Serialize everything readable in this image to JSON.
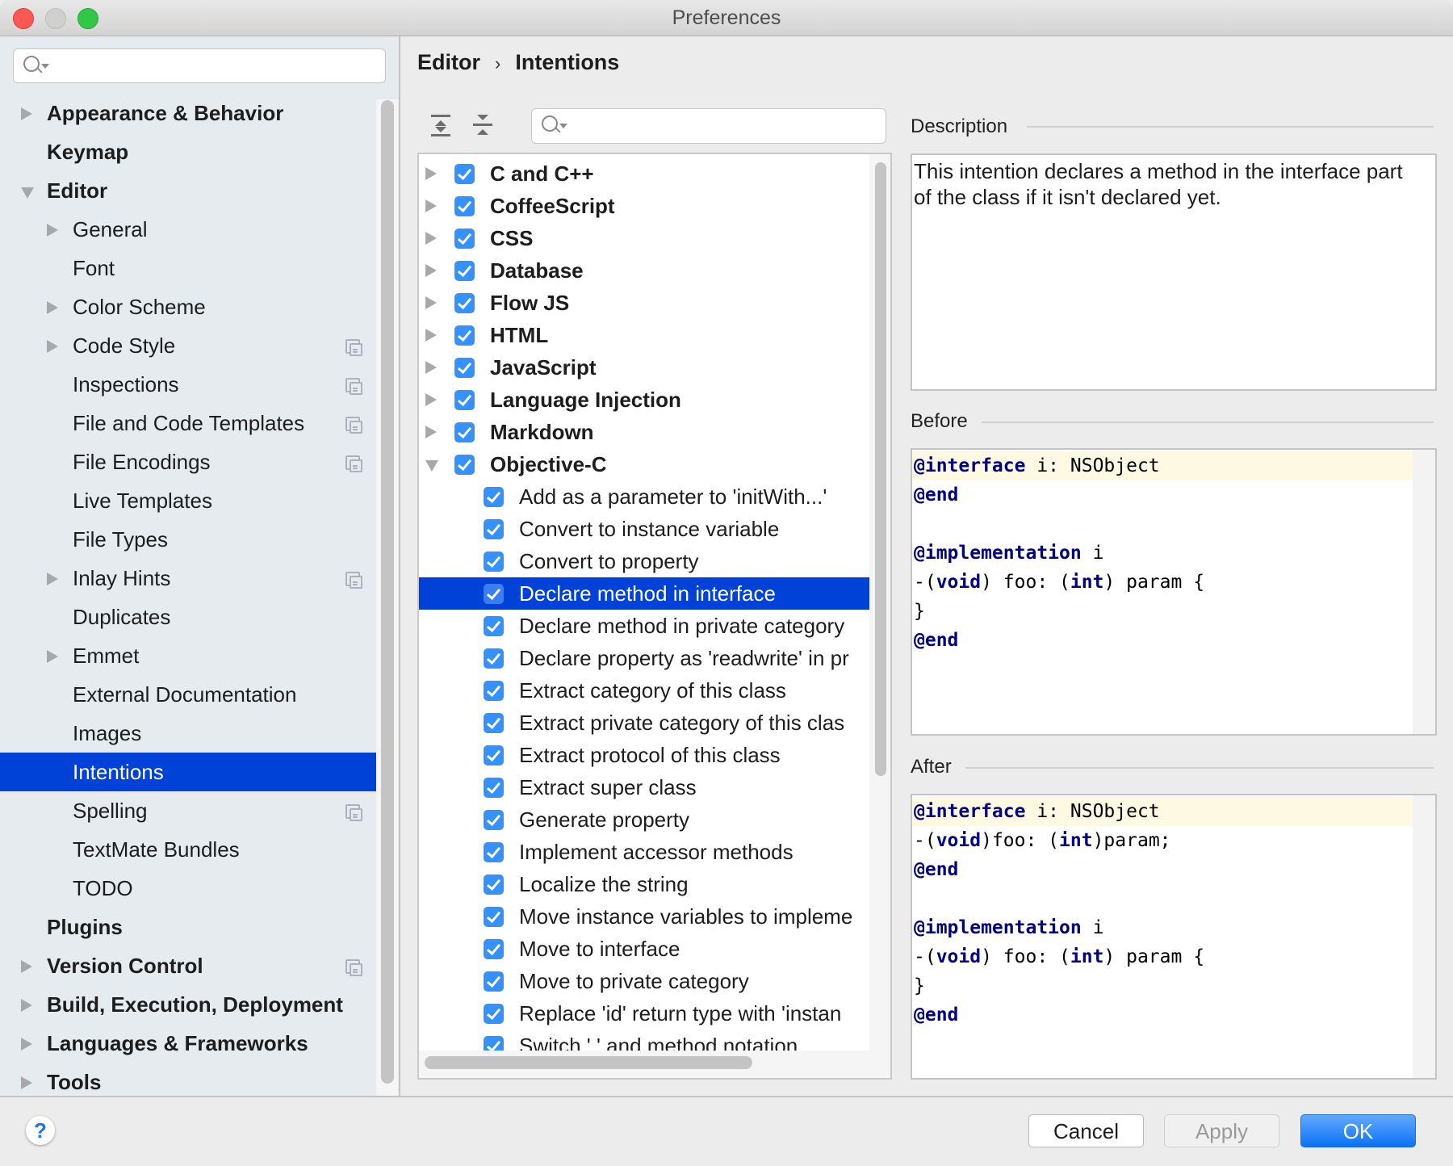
{
  "window": {
    "title": "Preferences"
  },
  "sidebar": {
    "search_placeholder": "",
    "items": [
      {
        "label": "Appearance & Behavior",
        "level": 0,
        "bold": true,
        "arrow": "right",
        "project": false
      },
      {
        "label": "Keymap",
        "level": 0,
        "bold": true,
        "arrow": "none",
        "project": false
      },
      {
        "label": "Editor",
        "level": 0,
        "bold": true,
        "arrow": "down",
        "project": false
      },
      {
        "label": "General",
        "level": 1,
        "bold": false,
        "arrow": "right",
        "project": false
      },
      {
        "label": "Font",
        "level": 1,
        "bold": false,
        "arrow": "none",
        "project": false
      },
      {
        "label": "Color Scheme",
        "level": 1,
        "bold": false,
        "arrow": "right",
        "project": false
      },
      {
        "label": "Code Style",
        "level": 1,
        "bold": false,
        "arrow": "right",
        "project": true
      },
      {
        "label": "Inspections",
        "level": 1,
        "bold": false,
        "arrow": "none",
        "project": true
      },
      {
        "label": "File and Code Templates",
        "level": 1,
        "bold": false,
        "arrow": "none",
        "project": true
      },
      {
        "label": "File Encodings",
        "level": 1,
        "bold": false,
        "arrow": "none",
        "project": true
      },
      {
        "label": "Live Templates",
        "level": 1,
        "bold": false,
        "arrow": "none",
        "project": false
      },
      {
        "label": "File Types",
        "level": 1,
        "bold": false,
        "arrow": "none",
        "project": false
      },
      {
        "label": "Inlay Hints",
        "level": 1,
        "bold": false,
        "arrow": "right",
        "project": true
      },
      {
        "label": "Duplicates",
        "level": 1,
        "bold": false,
        "arrow": "none",
        "project": false
      },
      {
        "label": "Emmet",
        "level": 1,
        "bold": false,
        "arrow": "right",
        "project": false
      },
      {
        "label": "External Documentation",
        "level": 1,
        "bold": false,
        "arrow": "none",
        "project": false
      },
      {
        "label": "Images",
        "level": 1,
        "bold": false,
        "arrow": "none",
        "project": false
      },
      {
        "label": "Intentions",
        "level": 1,
        "bold": false,
        "arrow": "none",
        "project": false,
        "selected": true
      },
      {
        "label": "Spelling",
        "level": 1,
        "bold": false,
        "arrow": "none",
        "project": true
      },
      {
        "label": "TextMate Bundles",
        "level": 1,
        "bold": false,
        "arrow": "none",
        "project": false
      },
      {
        "label": "TODO",
        "level": 1,
        "bold": false,
        "arrow": "none",
        "project": false
      },
      {
        "label": "Plugins",
        "level": 0,
        "bold": true,
        "arrow": "none",
        "project": false
      },
      {
        "label": "Version Control",
        "level": 0,
        "bold": true,
        "arrow": "right",
        "project": true
      },
      {
        "label": "Build, Execution, Deployment",
        "level": 0,
        "bold": true,
        "arrow": "right",
        "project": false
      },
      {
        "label": "Languages & Frameworks",
        "level": 0,
        "bold": true,
        "arrow": "right",
        "project": false
      },
      {
        "label": "Tools",
        "level": 0,
        "bold": true,
        "arrow": "right",
        "project": false
      }
    ]
  },
  "breadcrumb": {
    "parent": "Editor",
    "separator": "›",
    "current": "Intentions"
  },
  "toolbar": {
    "expand_all_icon": "expand-all-icon",
    "collapse_all_icon": "collapse-all-icon",
    "search_placeholder": ""
  },
  "intentions_tree": [
    {
      "label": "C and C++",
      "group": true,
      "expanded": false,
      "checked": true
    },
    {
      "label": "CoffeeScript",
      "group": true,
      "expanded": false,
      "checked": true
    },
    {
      "label": "CSS",
      "group": true,
      "expanded": false,
      "checked": true
    },
    {
      "label": "Database",
      "group": true,
      "expanded": false,
      "checked": true
    },
    {
      "label": "Flow JS",
      "group": true,
      "expanded": false,
      "checked": true
    },
    {
      "label": "HTML",
      "group": true,
      "expanded": false,
      "checked": true
    },
    {
      "label": "JavaScript",
      "group": true,
      "expanded": false,
      "checked": true
    },
    {
      "label": "Language Injection",
      "group": true,
      "expanded": false,
      "checked": true
    },
    {
      "label": "Markdown",
      "group": true,
      "expanded": false,
      "checked": true
    },
    {
      "label": "Objective-C",
      "group": true,
      "expanded": true,
      "checked": true
    },
    {
      "label": "Add as a parameter to 'initWith...'",
      "group": false,
      "checked": true
    },
    {
      "label": "Convert to instance variable",
      "group": false,
      "checked": true
    },
    {
      "label": "Convert to property",
      "group": false,
      "checked": true
    },
    {
      "label": "Declare method in interface",
      "group": false,
      "checked": true,
      "selected": true
    },
    {
      "label": "Declare method in private category",
      "group": false,
      "checked": true
    },
    {
      "label": "Declare property as 'readwrite' in pr",
      "group": false,
      "checked": true
    },
    {
      "label": "Extract category of this class",
      "group": false,
      "checked": true
    },
    {
      "label": "Extract private category of this clas",
      "group": false,
      "checked": true
    },
    {
      "label": "Extract protocol of this class",
      "group": false,
      "checked": true
    },
    {
      "label": "Extract super class",
      "group": false,
      "checked": true
    },
    {
      "label": "Generate property",
      "group": false,
      "checked": true
    },
    {
      "label": "Implement accessor methods",
      "group": false,
      "checked": true
    },
    {
      "label": "Localize the string",
      "group": false,
      "checked": true
    },
    {
      "label": "Move instance variables to impleme",
      "group": false,
      "checked": true
    },
    {
      "label": "Move to interface",
      "group": false,
      "checked": true
    },
    {
      "label": "Move to private category",
      "group": false,
      "checked": true
    },
    {
      "label": "Replace 'id' return type with 'instan",
      "group": false,
      "checked": true
    },
    {
      "label": "Switch '.' and method notation",
      "group": false,
      "checked": true
    }
  ],
  "description": {
    "label": "Description",
    "text": "This intention declares a method in the interface part of the class if it isn't declared yet."
  },
  "before": {
    "label": "Before",
    "lines": [
      [
        {
          "t": "@interface",
          "kw": true
        },
        {
          "t": " i: NSObject"
        }
      ],
      [
        {
          "t": "@end",
          "kw": true
        }
      ],
      [],
      [
        {
          "t": "@implementation",
          "kw": true
        },
        {
          "t": " i"
        }
      ],
      [
        {
          "t": "-("
        },
        {
          "t": "void",
          "kw": true
        },
        {
          "t": ") foo: ("
        },
        {
          "t": "int",
          "kw": true
        },
        {
          "t": ") param {"
        }
      ],
      [
        {
          "t": "}"
        }
      ],
      [
        {
          "t": "@end",
          "kw": true
        }
      ]
    ]
  },
  "after": {
    "label": "After",
    "lines": [
      [
        {
          "t": "@interface",
          "kw": true
        },
        {
          "t": " i: NSObject"
        }
      ],
      [
        {
          "t": "-("
        },
        {
          "t": "void",
          "kw": true
        },
        {
          "t": ")foo: ("
        },
        {
          "t": "int",
          "kw": true
        },
        {
          "t": ")param;"
        }
      ],
      [
        {
          "t": "@end",
          "kw": true
        }
      ],
      [],
      [
        {
          "t": "@implementation",
          "kw": true
        },
        {
          "t": " i"
        }
      ],
      [
        {
          "t": "-("
        },
        {
          "t": "void",
          "kw": true
        },
        {
          "t": ") foo: ("
        },
        {
          "t": "int",
          "kw": true
        },
        {
          "t": ") param {"
        }
      ],
      [
        {
          "t": "}"
        }
      ],
      [
        {
          "t": "@end",
          "kw": true
        }
      ]
    ]
  },
  "footer": {
    "help_label": "?",
    "cancel_label": "Cancel",
    "apply_label": "Apply",
    "ok_label": "OK"
  },
  "colors": {
    "selection": "#0041d8",
    "checkbox": "#3591fb",
    "keyword": "#000080",
    "primary_button": "#0a72f5",
    "caret_line": "#fdf9e2"
  }
}
